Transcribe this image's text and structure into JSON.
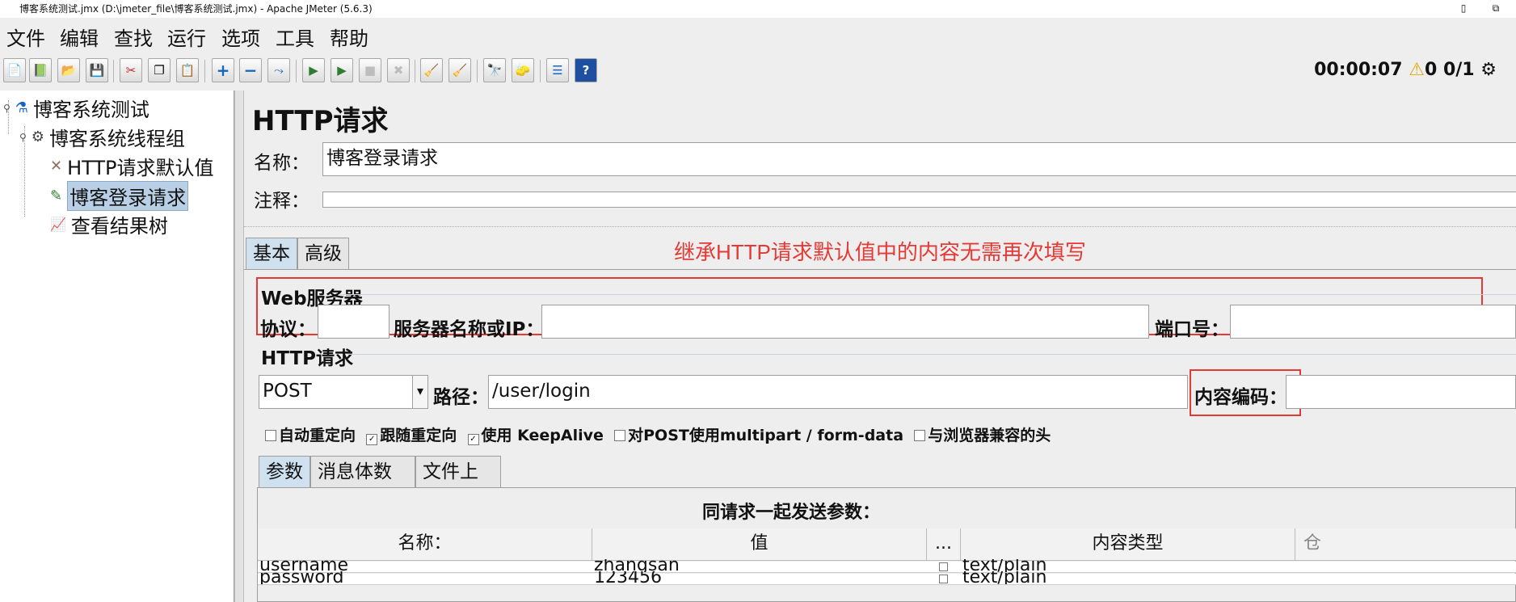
{
  "window": {
    "title": "博客系统测试.jmx (D:\\jmeter_file\\博客系统测试.jmx) - Apache JMeter (5.6.3)",
    "restore_glyph": "▯",
    "maximize_glyph": "⧉"
  },
  "menu": [
    "文件",
    "编辑",
    "查找",
    "运行",
    "选项",
    "工具",
    "帮助"
  ],
  "toolbar": {
    "icons": [
      "new-icon",
      "templates-icon",
      "open-icon",
      "save-icon",
      "cut-icon",
      "copy-icon",
      "paste-icon",
      "expand-icon",
      "collapse-icon",
      "toggle-icon",
      "start-icon",
      "start-no-pause-icon",
      "stop-icon",
      "shutdown-icon",
      "clear-icon",
      "clear-all-icon",
      "search-icon",
      "reset-search-icon",
      "function-helper-icon",
      "help-icon"
    ],
    "glyphs": [
      "📄",
      "📗",
      "📂",
      "💾",
      "✂",
      "❐",
      "📋",
      "+",
      "−",
      "⤳",
      "▶",
      "▶",
      "■",
      "✖",
      "🧹",
      "🧹",
      "🔭",
      "🧽",
      "☰",
      "?"
    ]
  },
  "status": {
    "elapsed": "00:00:07",
    "warnings": "0",
    "threads": "0/1",
    "warning_glyph": "⚠",
    "log_glyph": "⚙"
  },
  "tree": {
    "items": [
      {
        "label": "博客系统测试",
        "icon": "test-plan-icon",
        "glyph": "⚗"
      },
      {
        "label": "博客系统线程组",
        "icon": "thread-group-icon",
        "glyph": "⚙"
      },
      {
        "label": "HTTP请求默认值",
        "icon": "config-element-icon",
        "glyph": "✕"
      },
      {
        "label": "博客登录请求",
        "icon": "sampler-icon",
        "glyph": "✎"
      },
      {
        "label": "查看结果树",
        "icon": "listener-icon",
        "glyph": "📈"
      }
    ]
  },
  "panel": {
    "title": "HTTP请求",
    "name_label": "名称：",
    "name_value": "博客登录请求",
    "comment_label": "注释：",
    "comment_value": "",
    "tabs": [
      "基本",
      "高级"
    ],
    "annotation": "继承HTTP请求默认值中的内容无需再次填写",
    "web_server": {
      "legend": "Web服务器",
      "protocol_label": "协议：",
      "protocol_value": "",
      "server_label": "服务器名称或IP：",
      "server_value": "",
      "port_label": "端口号：",
      "port_value": ""
    },
    "http_request": {
      "legend": "HTTP请求",
      "method": "POST",
      "path_label": "路径：",
      "path_value": "/user/login",
      "encoding_label": "内容编码：",
      "encoding_value": "",
      "dropdown_glyph": "▾"
    },
    "options": [
      {
        "label": "自动重定向",
        "checked": false
      },
      {
        "label": "跟随重定向",
        "checked": true
      },
      {
        "label": "使用 KeepAlive",
        "checked": true
      },
      {
        "label": "对POST使用multipart / form-data",
        "checked": false
      },
      {
        "label": "与浏览器兼容的头",
        "checked": false
      }
    ],
    "sub_tabs": [
      "参数",
      "消息体数据",
      "文件上传"
    ],
    "params": {
      "caption": "同请求一起发送参数：",
      "headers": [
        "名称：",
        "值",
        "...",
        "内容类型",
        "仓"
      ],
      "rows": [
        {
          "name": "username",
          "value": "zhangsan",
          "encode": false,
          "content_type": "text/plain"
        },
        {
          "name": "password",
          "value": "123456",
          "encode": false,
          "content_type": "text/plain"
        }
      ]
    }
  }
}
